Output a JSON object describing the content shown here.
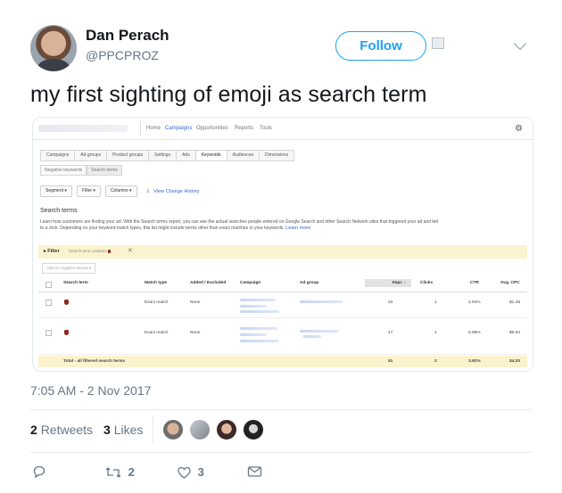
{
  "author": {
    "name": "Dan Perach",
    "handle": "@PPCPROZ"
  },
  "follow_label": "Follow",
  "tweet_text": "my first sighting of emoji as search term",
  "screenshot": {
    "nav": [
      "Home",
      "Campaigns",
      "Opportunities",
      "Reports",
      "Tools"
    ],
    "tabs": [
      "Campaigns",
      "Ad groups",
      "Product groups",
      "Settings",
      "Ads",
      "Keywords",
      "Audiences",
      "Dimensions"
    ],
    "subtabs": [
      "Negative keywords",
      "Search terms"
    ],
    "buttons": [
      "Segment ▾",
      "Filter ▾",
      "Columns ▾"
    ],
    "history_link": "View Change History",
    "section_title": "Search terms",
    "description": "Learn how customers are finding your ad. With the Search terms report, you can see the actual searches people entered on Google Search and other Search Network sites that triggered your ad and led to a click. Depending on your keyword match types, this list might include terms other than exact matches to your keywords.",
    "learn_more": "Learn more",
    "filter_label": "▸ Filter",
    "filter_chip": "Search term contains",
    "add_negative": "Add as negative keyword",
    "columns": [
      "Search term",
      "Match type",
      "Added / Excluded",
      "Campaign",
      "Ad group",
      "Impr.",
      "Clicks",
      "CTR",
      "Avg. CPC"
    ],
    "rows": [
      {
        "match_type": "Exact match",
        "added": "None",
        "impr": "34",
        "clicks": "1",
        "ctr": "2.94%",
        "cpc": "$1.45"
      },
      {
        "match_type": "Exact match",
        "added": "None",
        "impr": "17",
        "clicks": "1",
        "ctr": "5.88%",
        "cpc": "$6.94"
      }
    ],
    "total": {
      "label": "Total - all filtered search terms",
      "impr": "51",
      "clicks": "2",
      "ctr": "3.92%",
      "cpc": "$4.20"
    }
  },
  "timestamp": "7:05 AM - 2 Nov 2017",
  "stats": {
    "retweets": "2",
    "retweets_label": "Retweets",
    "likes": "3",
    "likes_label": "Likes"
  },
  "actions": {
    "retweet_count": "2",
    "like_count": "3"
  },
  "colors": {
    "accent": "#1da1f2",
    "muted": "#657786",
    "filter_bg": "#fbf3cd"
  }
}
